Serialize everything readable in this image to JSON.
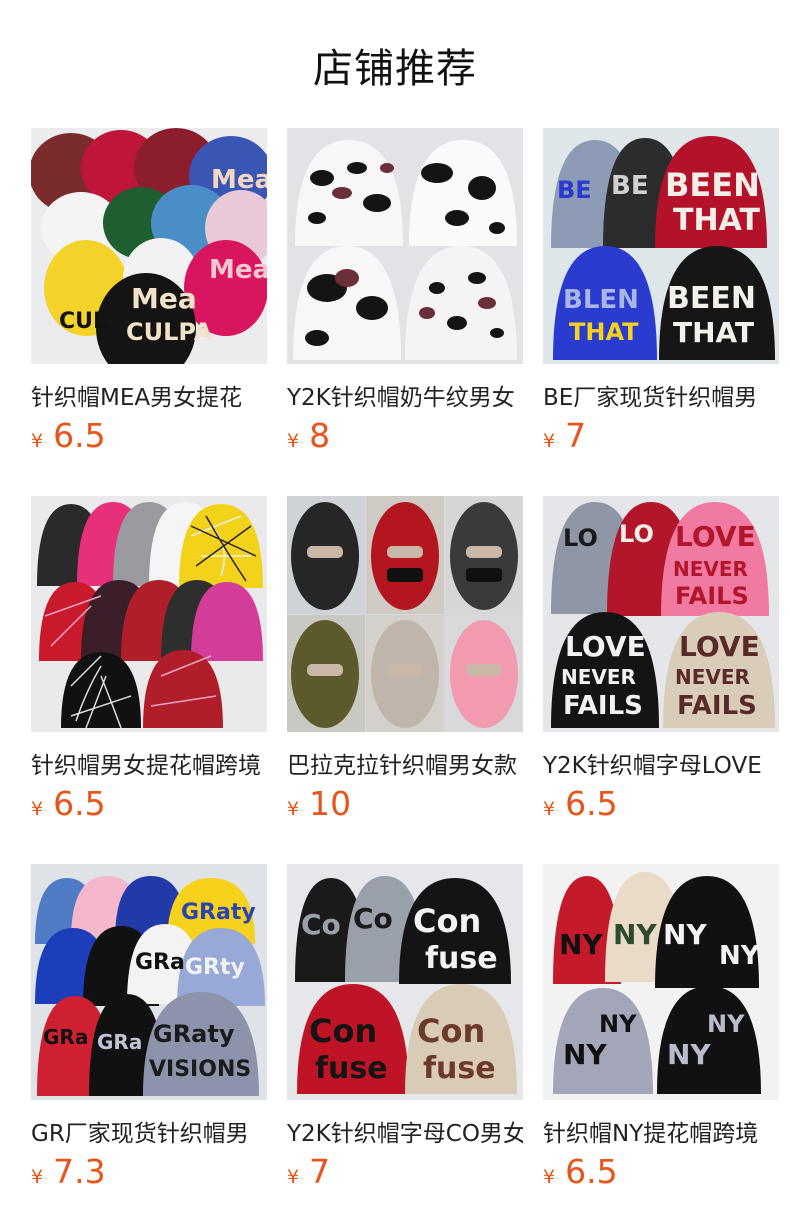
{
  "page": {
    "title": "店铺推荐"
  },
  "products": [
    {
      "name": "针织帽MEA男女提花",
      "currency": "¥",
      "price": "6.5",
      "image": "mea-culpa-beanies",
      "colors": [
        "#7a2b2b",
        "#c0153b",
        "#f2d7b0",
        "#1a1a1a",
        "#e14e7e",
        "#3a56b5"
      ]
    },
    {
      "name": "Y2K针织帽奶牛纹男女",
      "currency": "¥",
      "price": "8",
      "image": "cow-print-beanies",
      "colors": [
        "#ffffff",
        "#1a1a1a",
        "#6b2f3a"
      ]
    },
    {
      "name": "BE厂家现货针织帽男",
      "currency": "¥",
      "price": "7",
      "image": "been-that-beanies",
      "colors": [
        "#8e9bb7",
        "#2c2c2c",
        "#b3122a",
        "#2a3bd0",
        "#1a1a1a"
      ]
    },
    {
      "name": "针织帽男女提花帽跨境",
      "currency": "¥",
      "price": "6.5",
      "image": "spider-web-beanies",
      "colors": [
        "#222",
        "#e8307a",
        "#9a9aa0",
        "#f3d21b",
        "#c81a2a",
        "#f5f5f5",
        "#d43c9a",
        "#b01e2a"
      ]
    },
    {
      "name": "巴拉克拉针织帽男女款",
      "currency": "¥",
      "price": "10",
      "image": "balaclava-masks",
      "colors": [
        "#2b2b2b",
        "#b3161d",
        "#c9c9c9",
        "#6b6a2e",
        "#cfc6bd",
        "#f19ab0"
      ]
    },
    {
      "name": "Y2K针织帽字母LOVE",
      "currency": "¥",
      "price": "6.5",
      "image": "love-never-fails-beanies",
      "colors": [
        "#8f96a6",
        "#b3162b",
        "#f17aa2",
        "#1a1a1a",
        "#d9cdb9"
      ]
    },
    {
      "name": "GR厂家现货针织帽男",
      "currency": "¥",
      "price": "7.3",
      "image": "grafity-visions-beanies",
      "colors": [
        "#4f7cc5",
        "#f4b7cc",
        "#223aa7",
        "#f7d21d",
        "#1c3ebb",
        "#111",
        "#cf2032",
        "#8c93aa",
        "#98a9d8"
      ]
    },
    {
      "name": "Y2K针织帽字母CO男女",
      "currency": "¥",
      "price": "7",
      "image": "confuse-beanies",
      "colors": [
        "#1a1a1a",
        "#9aa0a9",
        "#bf1326",
        "#d9cbb6"
      ]
    },
    {
      "name": "针织帽NY提花帽跨境",
      "currency": "¥",
      "price": "6.5",
      "image": "ny-beanies",
      "colors": [
        "#c41a2a",
        "#eadbc8",
        "#111",
        "#a3a6b8"
      ]
    }
  ]
}
